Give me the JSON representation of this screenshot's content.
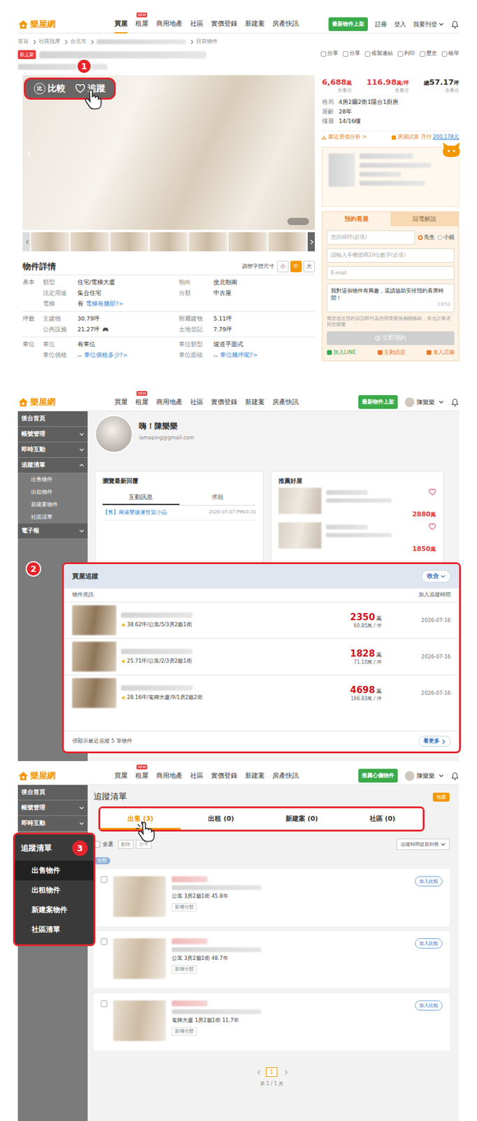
{
  "property_page": {
    "header": {
      "logo": "樂屋網",
      "nav": [
        {
          "label": "買屋",
          "selected": true,
          "badge": ""
        },
        {
          "label": "租屋",
          "selected": false,
          "badge": "NEW"
        },
        {
          "label": "商用地產",
          "selected": false,
          "badge": ""
        },
        {
          "label": "社區",
          "selected": false,
          "badge": ""
        },
        {
          "label": "實價登錄",
          "selected": false,
          "badge": ""
        },
        {
          "label": "新建案",
          "selected": false,
          "badge": ""
        },
        {
          "label": "房產快訊",
          "selected": false,
          "badge": ""
        }
      ],
      "promo": "最新物件上架",
      "links": [
        "註冊",
        "登入",
        "我要刊登"
      ],
      "user": ""
    },
    "breadcrumb": [
      {
        "kind": "text",
        "label": "首頁"
      },
      {
        "kind": "text",
        "label": "社區找屋"
      },
      {
        "kind": "text",
        "label": "台北市"
      },
      {
        "kind": "blur"
      },
      {
        "kind": "text",
        "label": "目前物件"
      }
    ],
    "badge": "新上架",
    "share": [
      "分享",
      "分享",
      "複製連結",
      "列印",
      "歷史",
      "檢舉"
    ],
    "step": "1",
    "photo_actions": [
      {
        "kind": "compare",
        "glyph": "比",
        "label": "比較"
      },
      {
        "kind": "track",
        "label": "追蹤"
      }
    ],
    "prices": [
      {
        "prefix": "",
        "value": "6,688",
        "unit": "萬",
        "note": "含車位",
        "color": "#e4393c"
      },
      {
        "prefix": "",
        "value": "116.98",
        "unit": "萬/坪",
        "note": "含車位",
        "color": "#e4393c"
      },
      {
        "prefix": "總",
        "value": "57.17",
        "unit": "坪",
        "note": "含車位",
        "color": "#333333"
      }
    ],
    "facts": [
      {
        "label": "格局",
        "value": "4房2廳2衛1陽台1廚房"
      },
      {
        "label": "屋齡",
        "value": "28年"
      },
      {
        "label": "樓層",
        "value": "14/16樓"
      }
    ],
    "analysis": "鄰近房價分析 >",
    "loan": {
      "label": "房貸試算 月付",
      "value": "200,178元"
    },
    "contact": {
      "tabs": [
        {
          "label": "預約看屋",
          "selected": true
        },
        {
          "label": "回電解說",
          "selected": false
        }
      ],
      "name_placeholder": "您的稱呼(必填)",
      "genders": [
        {
          "label": "先生",
          "selected": true
        },
        {
          "label": "小姐",
          "selected": false
        }
      ],
      "phone_placeholder": "請輸入手機號碼10位數字(必填)",
      "email_placeholder": "E-mail",
      "message": "我對這個物件有興趣，還請協助安排預約看屋時間！",
      "count": "23/50",
      "notice": "當您送出預約資訊即代表您同意樂屋相關條款，並允許業者與您聯繫",
      "submit": "立即預約",
      "submit_disabled": true,
      "actions": [
        {
          "label": "加入LINE",
          "color": "#2fa84f"
        },
        {
          "label": "互動訊息",
          "color": "#e8772e"
        },
        {
          "label": "進入店舖",
          "color": "#e8772e"
        }
      ]
    },
    "details": {
      "title": "物件詳情",
      "font_label": "調整字體尺寸",
      "font_sizes": [
        {
          "label": "小",
          "selected": false
        },
        {
          "label": "中",
          "selected": true
        },
        {
          "label": "大",
          "selected": false
        }
      ],
      "groups": [
        {
          "group": "基本",
          "rows": [
            [
              {
                "label": "類型",
                "value": "住宅/電梯大廈",
                "link": "",
                "car": false
              },
              {
                "label": "朝向",
                "value": "坐北朝南",
                "link": "",
                "car": false
              }
            ],
            [
              {
                "label": "法定用途",
                "value": "集合住宅",
                "link": "",
                "car": false
              },
              {
                "label": "分類",
                "value": "中古屋",
                "link": "",
                "car": false
              }
            ],
            [
              {
                "label": "電梯",
                "value": "有",
                "link": "電梯有幾部?>",
                "car": false
              }
            ]
          ]
        },
        {
          "group": "坪數",
          "rows": [
            [
              {
                "label": "主建物",
                "value": "30.79坪",
                "link": "",
                "car": false
              },
              {
                "label": "附屬建物",
                "value": "5.11坪",
                "link": "",
                "car": false
              }
            ],
            [
              {
                "label": "公共設施",
                "value": "21.27坪",
                "link": "",
                "car": true
              },
              {
                "label": "土地登記",
                "value": "7.79坪",
                "link": "",
                "car": false
              }
            ]
          ]
        },
        {
          "group": "車位",
          "rows": [
            [
              {
                "label": "車位",
                "value": "有車位",
                "link": "",
                "car": false
              },
              {
                "label": "車位類型",
                "value": "坡道平面式",
                "link": "",
                "car": false
              }
            ],
            [
              {
                "label": "車位價格",
                "value": "--",
                "link": "車位價格多少?>",
                "car": false
              },
              {
                "label": "車位面積",
                "value": "--",
                "link": "車位幾坪呢?>",
                "car": false
              }
            ]
          ]
        }
      ]
    }
  },
  "dashboard": {
    "header": {
      "logo": "樂屋網",
      "nav": [
        {
          "label": "買屋",
          "selected": false,
          "badge": ""
        },
        {
          "label": "租屋",
          "selected": false,
          "badge": "NEW"
        },
        {
          "label": "商用地產",
          "selected": false,
          "badge": ""
        },
        {
          "label": "社區",
          "selected": false,
          "badge": ""
        },
        {
          "label": "實價登錄",
          "selected": false,
          "badge": ""
        },
        {
          "label": "新建案",
          "selected": false,
          "badge": ""
        },
        {
          "label": "房產快訊",
          "selected": false,
          "badge": ""
        }
      ],
      "promo": "最新物件上架",
      "links": [],
      "user": "陳樂樂"
    },
    "sidebar": [
      {
        "label": "後台首頁",
        "expandable": false,
        "expanded": false,
        "children": []
      },
      {
        "label": "帳號管理",
        "expandable": true,
        "expanded": false,
        "children": []
      },
      {
        "label": "即時互動",
        "expandable": true,
        "expanded": false,
        "children": []
      },
      {
        "label": "追蹤清單",
        "expandable": true,
        "expanded": true,
        "children": [
          "出售物件",
          "出租物件",
          "新建案物件",
          "社區清單"
        ]
      },
      {
        "label": "電子報",
        "expandable": true,
        "expanded": false,
        "children": []
      }
    ],
    "profile": {
      "greeting": "嗨！陳樂樂",
      "email": "iamaping@gmail.com"
    },
    "replies": {
      "title": "瀏覽最新回覆",
      "tabs": [
        {
          "label": "互動訊息",
          "selected": true
        },
        {
          "label": "求租",
          "selected": false
        }
      ],
      "rows": [
        {
          "title": "【售】南港雙捷運世貿小品",
          "time": "2026-07-07 PM03:20"
        }
      ]
    },
    "recommend": {
      "title": "推薦好屋",
      "items": [
        {
          "price": "2880",
          "unit": "萬"
        },
        {
          "price": "1850",
          "unit": "萬"
        }
      ]
    },
    "tracking": {
      "step": "2",
      "title": "買屋追蹤",
      "toggle": "收合",
      "columns": [
        "物件資訊",
        "加入追蹤時間"
      ],
      "rows": [
        {
          "spec": "38.62坪/公寓/5/3房2廳1衛",
          "price": "2350",
          "price_unit": "萬",
          "unit_price": "60.85萬 / 坪",
          "date": "2026-07-16"
        },
        {
          "spec": "25.71坪/公寓/2/3房2廳1衛",
          "price": "1828",
          "price_unit": "萬",
          "unit_price": "71.10萬 / 坪",
          "date": "2026-07-16"
        },
        {
          "spec": "28.16坪/電梯大廈/9/1房2廳2衛",
          "price": "4698",
          "price_unit": "萬",
          "unit_price": "166.83萬 / 坪",
          "date": "2026-07-16"
        }
      ],
      "footer": "僅顯示最近追蹤 5 筆物件",
      "more": "看更多"
    }
  },
  "tracking_list": {
    "header": {
      "logo": "樂屋網",
      "nav": [
        {
          "label": "買屋",
          "selected": false,
          "badge": ""
        },
        {
          "label": "租屋",
          "selected": false,
          "badge": "NEW"
        },
        {
          "label": "商用地產",
          "selected": false,
          "badge": ""
        },
        {
          "label": "社區",
          "selected": false,
          "badge": ""
        },
        {
          "label": "實價登錄",
          "selected": false,
          "badge": ""
        },
        {
          "label": "新建案",
          "selected": false,
          "badge": ""
        },
        {
          "label": "房產快訊",
          "selected": false,
          "badge": ""
        }
      ],
      "promo": "推薦心儀物件",
      "links": [],
      "user": "陳樂樂"
    },
    "sidebar": [
      {
        "label": "後台首頁",
        "expandable": false
      },
      {
        "label": "帳號管理",
        "expandable": true
      },
      {
        "label": "即時互動",
        "expandable": true
      }
    ],
    "highlight": {
      "step": "3",
      "title": "追蹤清單",
      "items": [
        {
          "label": "出售物件",
          "selected": true
        },
        {
          "label": "出租物件",
          "selected": false
        },
        {
          "label": "新建案物件",
          "selected": false
        },
        {
          "label": "社區清單",
          "selected": false
        }
      ]
    },
    "title": "追蹤清單",
    "map": "地圖",
    "tabs": [
      {
        "label": "出售 (3)",
        "selected": true
      },
      {
        "label": "出租 (0)",
        "selected": false
      },
      {
        "label": "新建案 (0)",
        "selected": false
      },
      {
        "label": "社區 (0)",
        "selected": false
      }
    ],
    "toolbar": {
      "select_all": "全選",
      "checked": false,
      "buttons": [
        "刪除",
        "分享"
      ],
      "sort": "追蹤時間從新到舊"
    },
    "filter": "全部",
    "items": [
      {
        "spec": "公寓 3房2廳1衛 45.8年",
        "category": "新增分類",
        "compare": "加入比較",
        "checked": false
      },
      {
        "spec": "公寓 3房2廳1衛 48.7年",
        "category": "新增分類",
        "compare": "加入比較",
        "checked": false
      },
      {
        "spec": "電梯大廈 1房2廳1衛 11.7年",
        "category": "新增分類",
        "compare": "加入比較",
        "checked": false
      }
    ],
    "pagination": {
      "pages": [
        {
          "label": "1",
          "selected": true
        }
      ],
      "summary": "第 1 / 1 頁"
    }
  }
}
